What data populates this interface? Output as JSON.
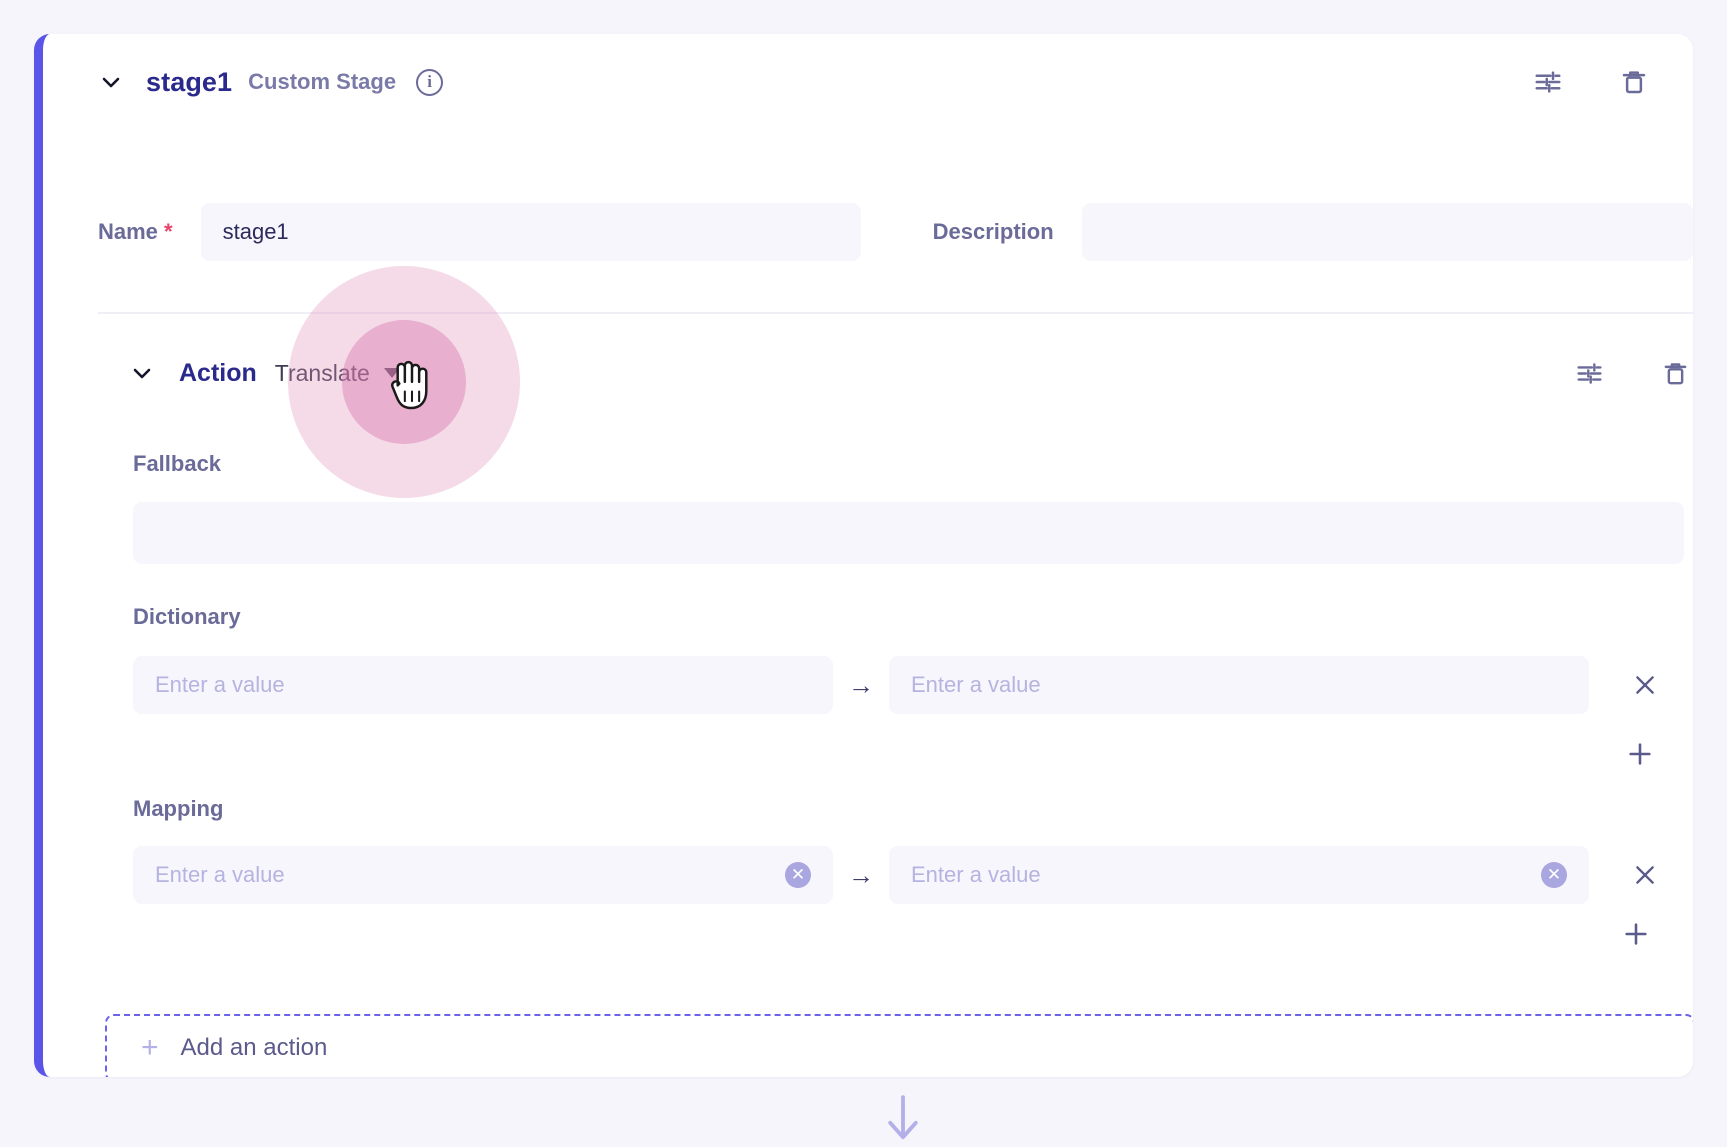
{
  "stage": {
    "collapse_icon": "chevron-down-icon",
    "title": "stage1",
    "subtitle": "Custom Stage",
    "info_icon": "info-icon",
    "settings_icon": "sliders-icon",
    "delete_icon": "trash-icon"
  },
  "name_field": {
    "label": "Name",
    "required_marker": "*",
    "value": "stage1",
    "placeholder": ""
  },
  "description_field": {
    "label": "Description",
    "value": "",
    "placeholder": ""
  },
  "action": {
    "collapse_icon": "chevron-down-icon",
    "title": "Action",
    "selected": "Translate",
    "caret_icon": "caret-down-icon",
    "settings_icon": "sliders-icon",
    "delete_icon": "trash-icon"
  },
  "fallback": {
    "label": "Fallback",
    "value": "",
    "placeholder": ""
  },
  "dictionary": {
    "label": "Dictionary",
    "arrow": "→",
    "rows": [
      {
        "key": "",
        "key_placeholder": "Enter a value",
        "value": "",
        "value_placeholder": "Enter a value"
      }
    ],
    "remove_icon": "close-icon",
    "add_icon": "plus-icon"
  },
  "mapping": {
    "label": "Mapping",
    "arrow": "→",
    "rows": [
      {
        "key": "",
        "key_placeholder": "Enter a value",
        "value": "",
        "value_placeholder": "Enter a value",
        "clear_icon": "clear-circle-icon"
      }
    ],
    "remove_icon": "close-icon",
    "add_icon": "plus-icon"
  },
  "add_action": {
    "plus": "+",
    "label": "Add an action"
  },
  "footer": {
    "down_arrow_icon": "arrow-down-icon"
  },
  "colors": {
    "accent": "#5b54e8",
    "title": "#2a2a8c",
    "label": "#6b6b99",
    "field_bg": "#f7f6fc",
    "page_bg": "#f6f5fb",
    "required": "#e8436b",
    "placeholder": "#b5b3e0",
    "ripple": "#d46ea8"
  }
}
